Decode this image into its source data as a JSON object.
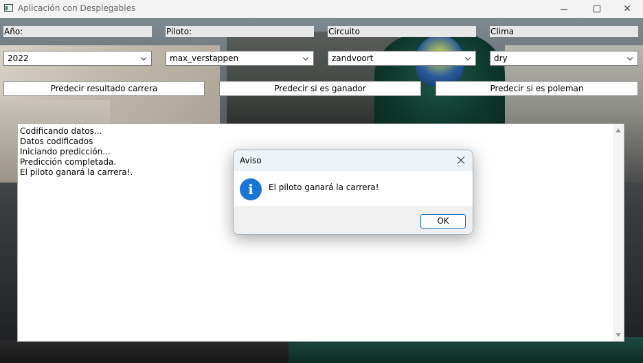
{
  "window": {
    "title": "Aplicación con Desplegables"
  },
  "labels": {
    "year": "Año:",
    "driver": "Piloto:",
    "circuit": "Circuito",
    "weather": "Clima"
  },
  "selects": {
    "year": "2022",
    "driver": "max_verstappen",
    "circuit": "zandvoort",
    "weather": "dry"
  },
  "actions": {
    "predict_result": "Predecir resultado carrera",
    "predict_winner": "Predecir si es ganador",
    "predict_pole": "Predecir si es poleman"
  },
  "output": {
    "lines": [
      "Codificando datos...",
      "Datos codificados",
      "Iniciando predicción...",
      "Predicción completada.",
      "El piloto ganará la carrera!."
    ]
  },
  "dialog": {
    "title": "Aviso",
    "message": "El piloto ganará la carrera!",
    "ok_label": "OK",
    "icon": "info-icon"
  },
  "colors": {
    "dialog_icon": "#1976d2",
    "ok_border": "#0067c0"
  }
}
